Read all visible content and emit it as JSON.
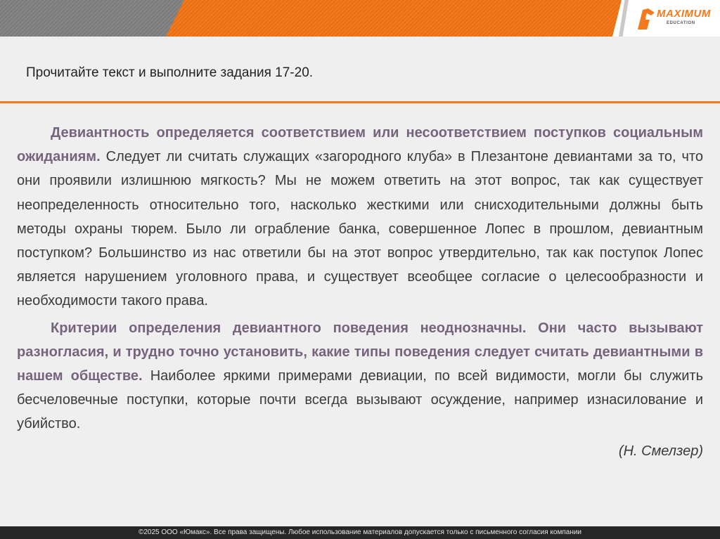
{
  "header": {
    "logo_brand": "MAXIMUM",
    "logo_sub": "EDUCATION"
  },
  "title": "Прочитайте текст и выполните задания 17-20.",
  "paragraphs": [
    {
      "highlight": "Девиантность определяется соответствием или несоответствием поступков социальным ожиданиям.",
      "text": " Следует ли считать служащих «загородного клуба» в Плезантоне девиантами за то, что они проявили излишнюю мягкость? Мы не можем ответить на этот вопрос, так как существует неопределенность относительно того, насколько жесткими или снисходительными должны быть методы охраны тюрем. Было ли ограбление банка, совершенное Лопес в прошлом, девиантным поступком? Большинство из нас ответили бы на этот вопрос утвердительно, так как поступок Лопес является нарушением уголовного права, и существует всеобщее согласие о целесообразности и необходимости такого права."
    },
    {
      "highlight": "Критерии определения девиантного поведения неоднозначны. Они часто вызывают разногласия, и трудно точно установить, какие типы поведения следует считать девиантными в нашем обществе.",
      "text": " Наиболее яркими примерами девиации, по всей видимости, могли бы служить бесчеловечные поступки, которые почти всегда вызывают осуждение, например изнасилование и убийство."
    }
  ],
  "author": "(Н. Смелзер)",
  "footer": "©2025 ООО «Юмакс». Все права защищены. Любое использование материалов допускается только с письменного согласия компании",
  "colors": {
    "accent": "#f47a1e",
    "highlight": "#76637e",
    "footer_bg": "#262626"
  }
}
